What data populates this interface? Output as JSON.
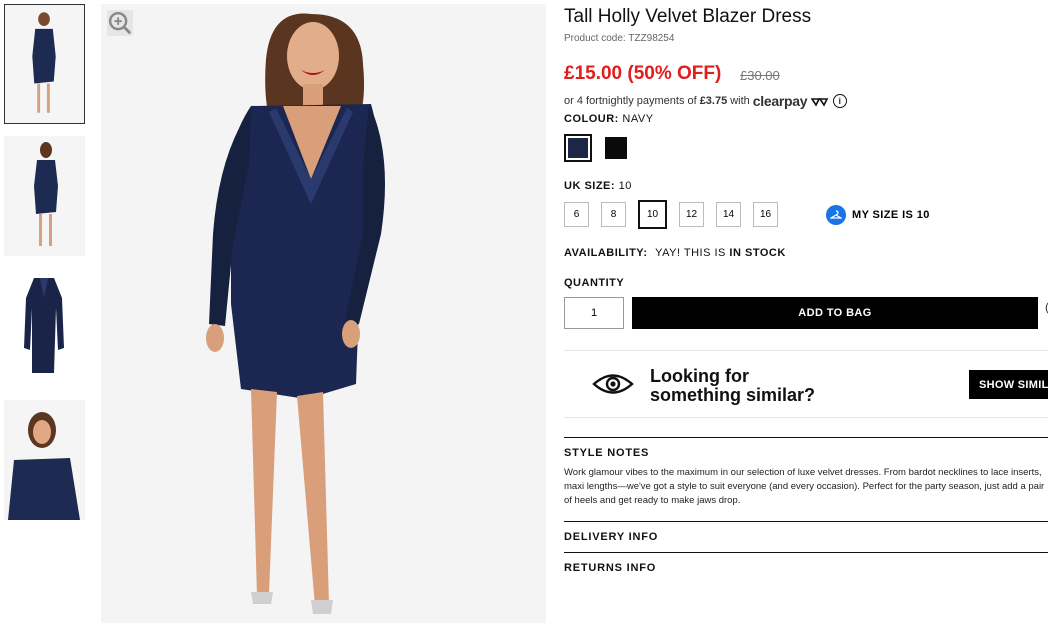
{
  "product": {
    "title": "Tall Holly Velvet Blazer Dress",
    "code": "Product code: TZZ98254",
    "price": "£15.00 (50% OFF)",
    "old_price": "£30.00",
    "payments_prefix": "or 4 fortnightly payments of",
    "payments_amount": "£3.75",
    "payments_with": "with",
    "clearpay_brand": "clearpay",
    "info_glyph": "i"
  },
  "colour": {
    "label": "COLOUR:",
    "value": "NAVY",
    "swatches": [
      {
        "name": "navy",
        "color": "#1c2748",
        "selected": true
      },
      {
        "name": "black",
        "color": "#0a0a0a",
        "selected": false
      }
    ]
  },
  "size": {
    "label": "UK SIZE:",
    "value": "10",
    "options": [
      "6",
      "8",
      "10",
      "12",
      "14",
      "16"
    ],
    "selected": "10",
    "my_size_label": "MY SIZE IS 10"
  },
  "availability": {
    "label": "AVAILABILITY:",
    "prefix": "YAY! THIS IS",
    "status": "IN STOCK"
  },
  "quantity": {
    "label": "QUANTITY",
    "value": "1"
  },
  "add_to_bag": "ADD TO BAG",
  "similar": {
    "line1": "Looking for",
    "line2": "something similar?",
    "button": "SHOW SIMILAR"
  },
  "style_notes": {
    "heading": "STYLE NOTES",
    "text": "Work glamour vibes to the maximum in our selection of luxe velvet dresses. From bardot necklines to lace inserts, maxi lengths—we've got a style to suit everyone (and every occasion). Perfect for the party season, just add a pair of heels and get ready to make jaws drop."
  },
  "delivery_info": "DELIVERY INFO",
  "returns_info": "RETURNS INFO",
  "icons": {
    "zoom": "zoom-in-icon",
    "eye": "eye-icon",
    "hanger": "hanger-icon",
    "info": "info-icon"
  }
}
